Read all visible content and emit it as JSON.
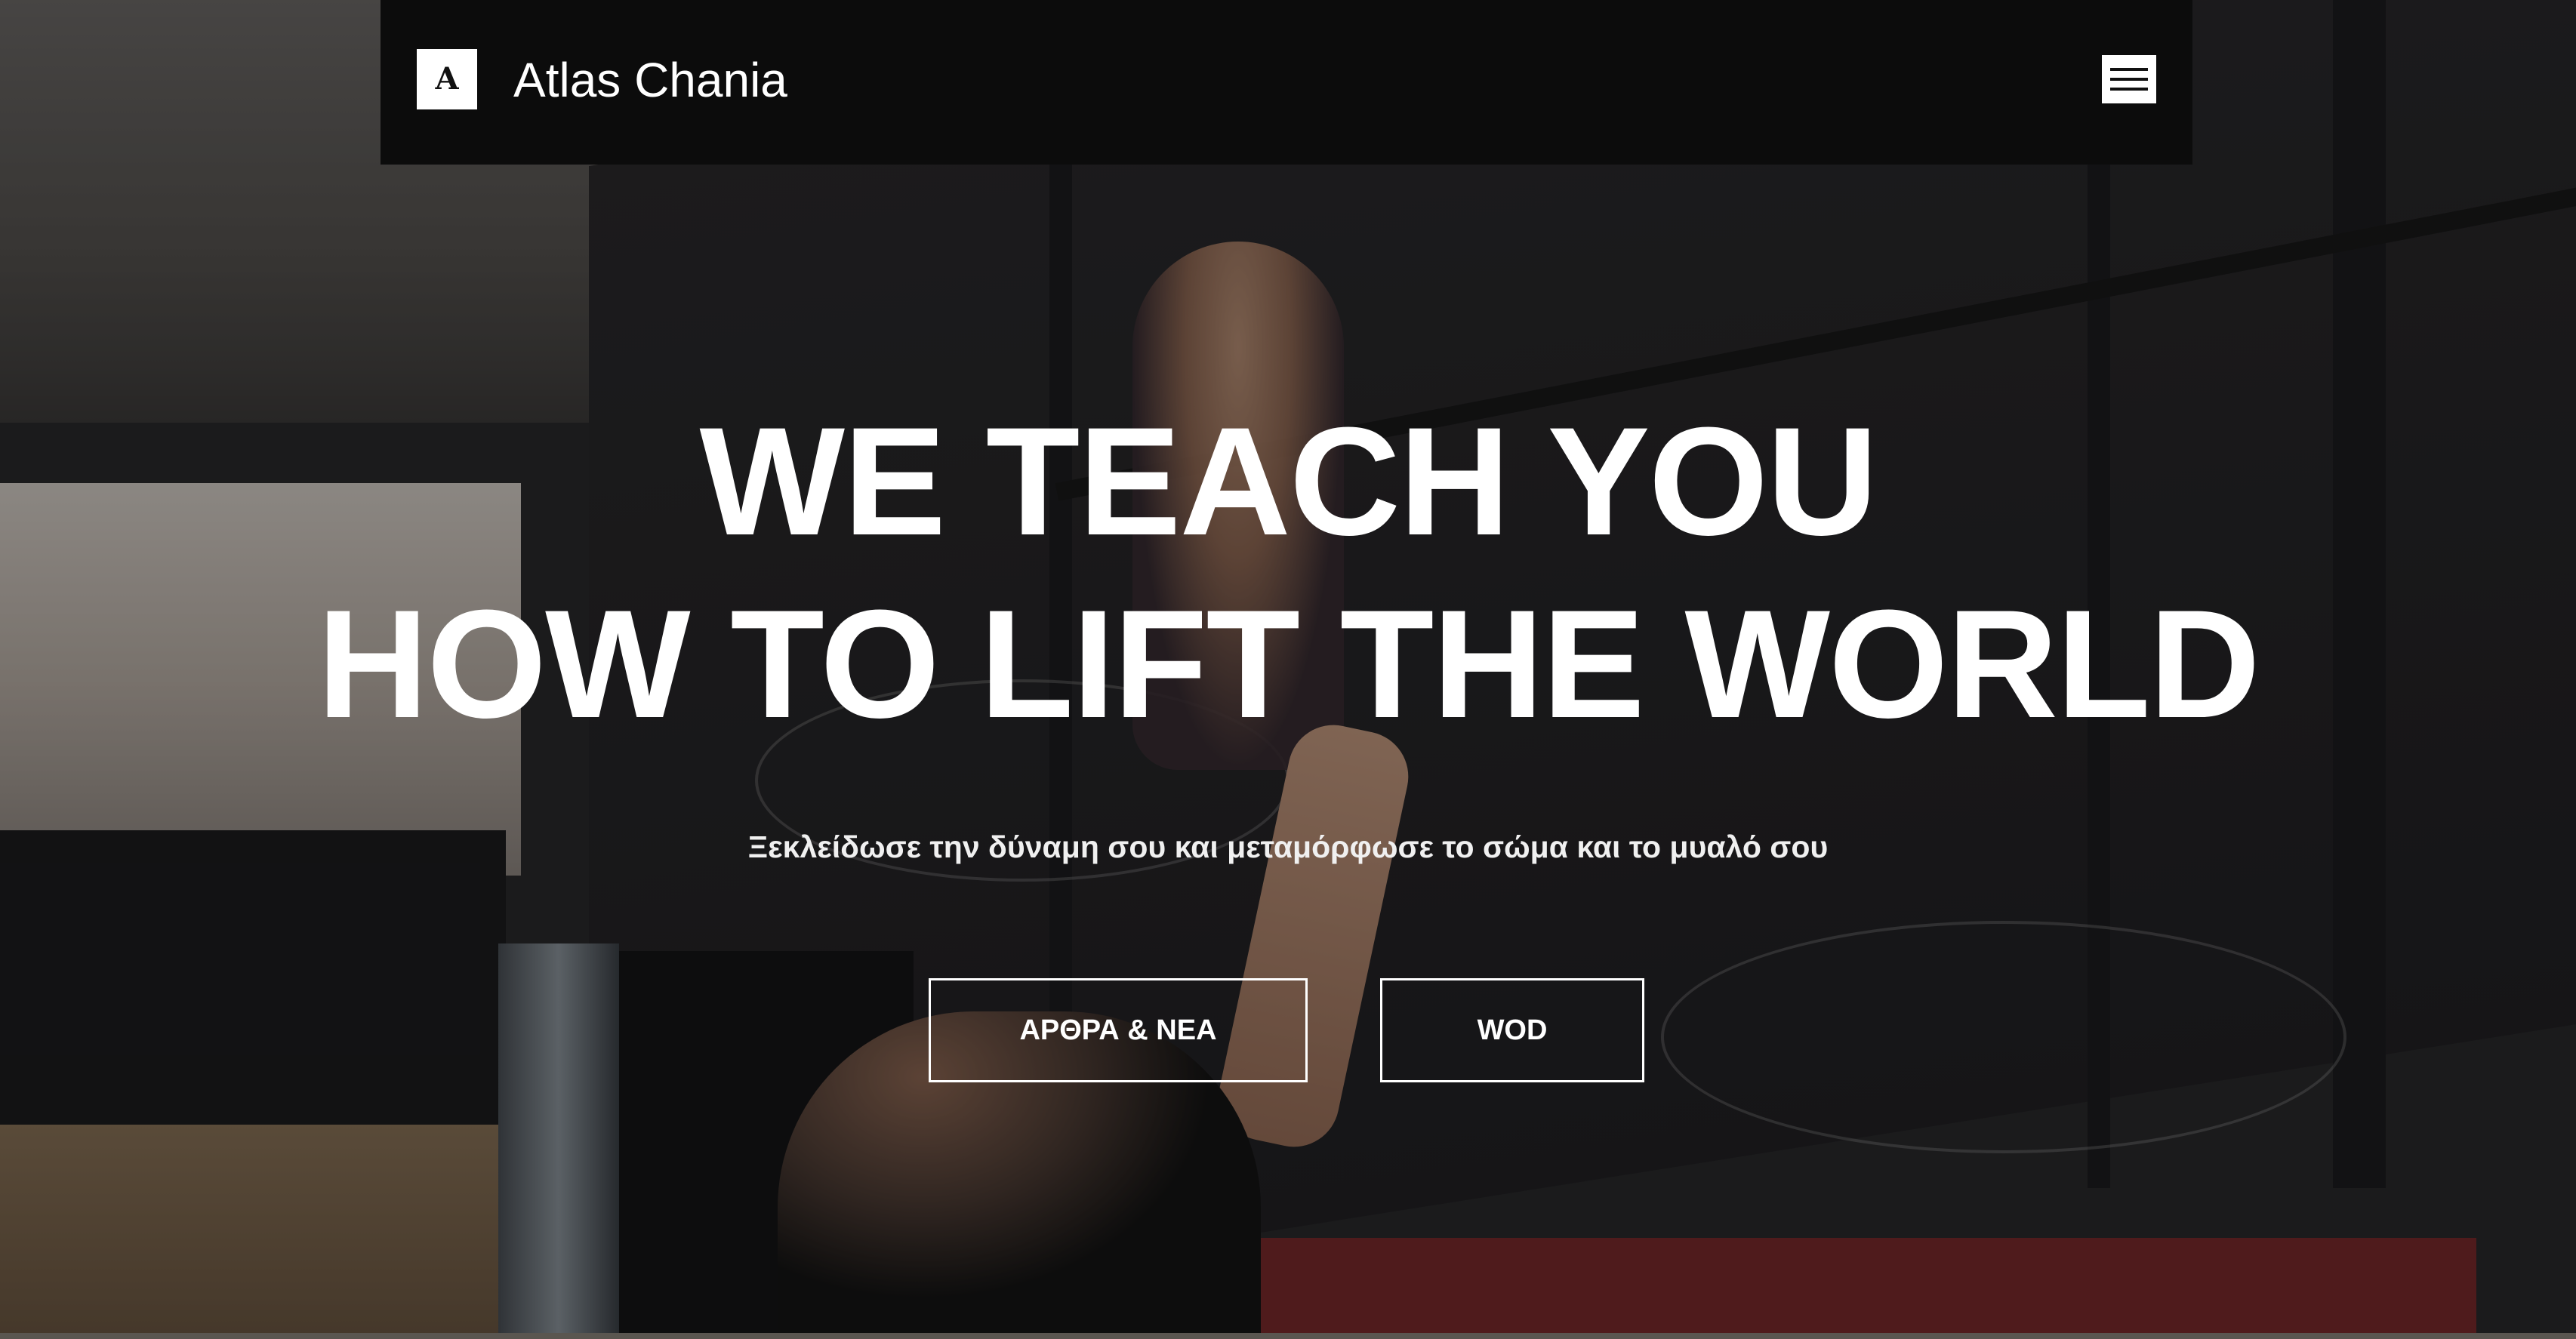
{
  "header": {
    "brand": "Atlas Chania",
    "logo_text": "A",
    "menu_icon": "hamburger-menu-icon"
  },
  "hero": {
    "title_line1": "WE TEACH YOU",
    "title_line2": "HOW TO LIFT THE WORLD",
    "subtitle": "Ξεκλείδωσε την δύναμη σου και μεταμόρφωσε το σώμα και το μυαλό σου"
  },
  "buttons": {
    "articles_label": "ΑΡΘΡΑ & ΝΕΑ",
    "wod_label": "WOD"
  },
  "colors": {
    "header_bg": "#0c0c0c",
    "text": "#ffffff",
    "button_border": "#ffffff"
  }
}
